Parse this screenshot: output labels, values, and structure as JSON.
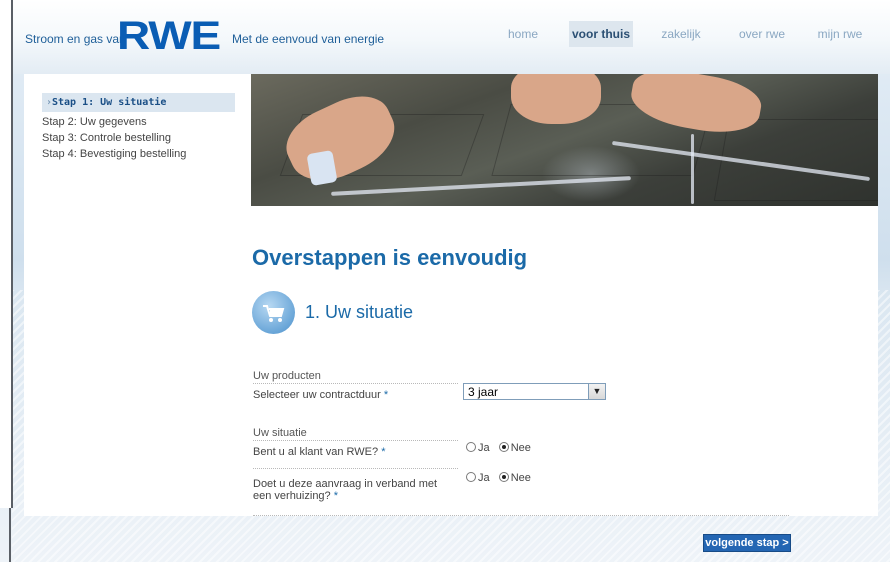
{
  "brand": {
    "tagline_left": "Stroom en gas van",
    "logo": "RWE",
    "tagline_right": "Met de eenvoud van energie"
  },
  "nav": {
    "items": [
      "home",
      "voor thuis",
      "zakelijk",
      "over rwe",
      "mijn rwe"
    ],
    "active": "voor thuis"
  },
  "steps": [
    "Stap 1: Uw situatie",
    "Stap 2: Uw gegevens",
    "Stap 3: Controle bestelling",
    "Stap 4: Bevestiging bestelling"
  ],
  "main": {
    "title": "Overstappen is eenvoudig",
    "subtitle": "1. Uw situatie",
    "icon": "cart-icon"
  },
  "form": {
    "products_label": "Uw producten",
    "contract_label": "Selecteer uw contractduur",
    "contract_value": "3 jaar",
    "situation_label": "Uw situatie",
    "customer_question": "Bent u al klant van RWE?",
    "moving_question": "Doet u deze aanvraag in verband met een verhuizing?",
    "required_marker": "*",
    "option_yes": "Ja",
    "option_no": "Nee",
    "customer_answer": "Nee",
    "moving_answer": "Nee"
  },
  "buttons": {
    "next": "volgende stap >"
  },
  "colors": {
    "brand_blue": "#0a5db4",
    "heading_blue": "#1b6aa8",
    "button_blue": "#2466b3"
  }
}
